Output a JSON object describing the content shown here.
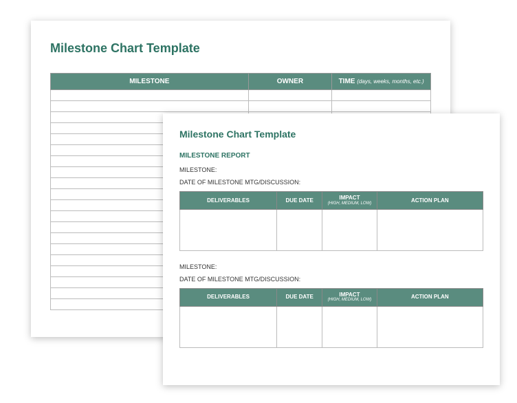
{
  "back": {
    "title": "Milestone Chart Template",
    "headers": {
      "milestone": "MILESTONE",
      "owner": "OWNER",
      "time": "TIME",
      "time_sub": "(days, weeks, months, etc.)"
    }
  },
  "front": {
    "title": "Milestone Chart Template",
    "section": "MILESTONE REPORT",
    "milestone_label": "MILESTONE:",
    "date_label": "DATE OF MILESTONE MTG/DISCUSSION:",
    "headers": {
      "deliverables": "DELIVERABLES",
      "due_date": "DUE DATE",
      "impact": "IMPACT",
      "impact_sub": "(HIGH, MEDIUM, LOW)",
      "action_plan": "ACTION PLAN"
    }
  }
}
